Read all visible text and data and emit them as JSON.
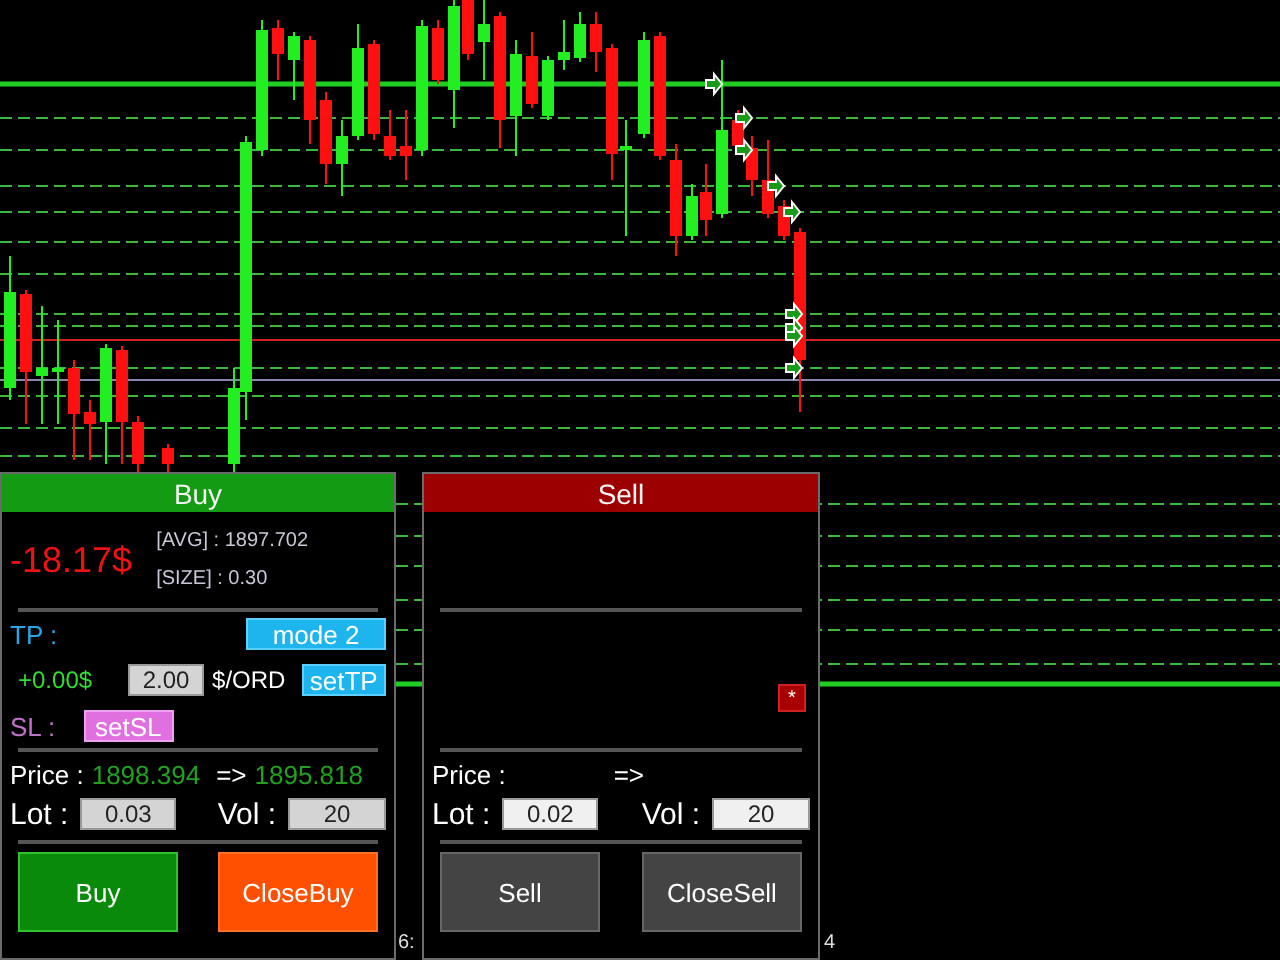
{
  "buy_panel": {
    "title": "Buy",
    "profit": "-18.17$",
    "avg_text": "[AVG] : 1897.702",
    "size_text": "[SIZE] : 0.30",
    "tp_label": "TP :",
    "tp_mode_button": "mode 2",
    "tp_profit": "+0.00$",
    "tp_amount": "2.00",
    "tp_unit": "$/ORD",
    "set_tp_button": "setTP",
    "sl_label": "SL :",
    "set_sl_button": "setSL",
    "price_label": "Price :",
    "price_value": "1898.394",
    "arrow": "=>",
    "target_value": "1895.818",
    "lot_label": "Lot :",
    "lot_value": "0.03",
    "vol_label": "Vol :",
    "vol_value": "20",
    "buttons": [
      {
        "label": "Buy",
        "kind": "open"
      },
      {
        "label": "CloseBuy",
        "kind": "close"
      }
    ]
  },
  "sell_panel": {
    "title": "Sell",
    "star_button": "*",
    "price_label": "Price :",
    "arrow": "=>",
    "lot_label": "Lot :",
    "lot_value": "0.02",
    "vol_label": "Vol :",
    "vol_value": "20",
    "buttons": [
      {
        "label": "Sell",
        "kind": "plain"
      },
      {
        "label": "CloseSell",
        "kind": "plain"
      }
    ]
  },
  "time_axis": [
    "6:",
    "4"
  ]
}
